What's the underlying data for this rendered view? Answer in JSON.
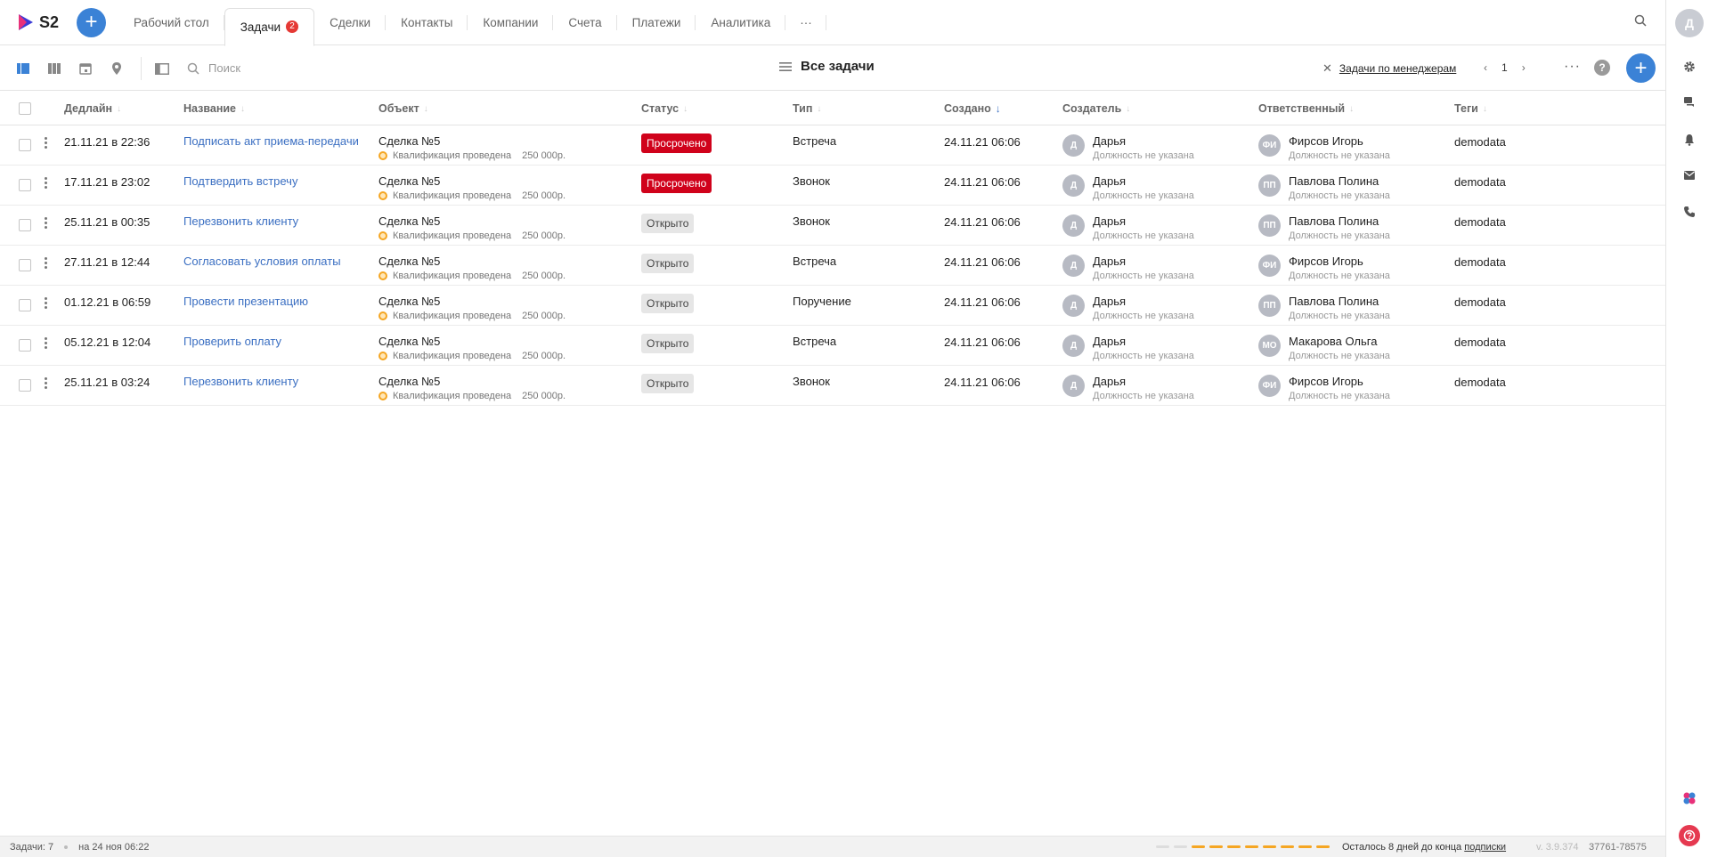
{
  "app": {
    "logo_text": "S2",
    "brand_color": "#3b82d6",
    "add_icon": "plus-icon"
  },
  "tabs": [
    {
      "label": "Рабочий стол"
    },
    {
      "label": "Задачи",
      "badge": "2",
      "active": true
    },
    {
      "label": "Сделки"
    },
    {
      "label": "Контакты"
    },
    {
      "label": "Компании"
    },
    {
      "label": "Счета"
    },
    {
      "label": "Платежи"
    },
    {
      "label": "Аналитика"
    },
    {
      "label": "···"
    }
  ],
  "user": {
    "initial": "Д"
  },
  "toolbar": {
    "search_placeholder": "Поиск",
    "view_title": "Все задачи",
    "filter_label": "Задачи по менеджерам",
    "page": "1",
    "more": "···",
    "help": "?"
  },
  "columns": {
    "deadline": "Дедлайн",
    "name": "Название",
    "object": "Объект",
    "status": "Статус",
    "type": "Тип",
    "created": "Создано",
    "creator": "Создатель",
    "responsible": "Ответственный",
    "tags": "Теги"
  },
  "rows": [
    {
      "deadline": "21.11.21 в 22:36",
      "name": "Подписать акт приема-передачи",
      "object": "Сделка №5",
      "stage": "Квалификация проведена",
      "amount": "250 000р.",
      "status": "Просрочено",
      "status_kind": "overdue",
      "type": "Встреча",
      "created": "24.11.21 06:06",
      "creator_initials": "Д",
      "creator": "Дарья",
      "creator_pos": "Должность не указана",
      "resp_initials": "ФИ",
      "responsible": "Фирсов Игорь",
      "resp_pos": "Должность не указана",
      "tags": "demodata"
    },
    {
      "deadline": "17.11.21 в 23:02",
      "name": "Подтвердить встречу",
      "object": "Сделка №5",
      "stage": "Квалификация проведена",
      "amount": "250 000р.",
      "status": "Просрочено",
      "status_kind": "overdue",
      "type": "Звонок",
      "created": "24.11.21 06:06",
      "creator_initials": "Д",
      "creator": "Дарья",
      "creator_pos": "Должность не указана",
      "resp_initials": "ПП",
      "responsible": "Павлова Полина",
      "resp_pos": "Должность не указана",
      "tags": "demodata"
    },
    {
      "deadline": "25.11.21 в 00:35",
      "name": "Перезвонить клиенту",
      "object": "Сделка №5",
      "stage": "Квалификация проведена",
      "amount": "250 000р.",
      "status": "Открыто",
      "status_kind": "open",
      "type": "Звонок",
      "created": "24.11.21 06:06",
      "creator_initials": "Д",
      "creator": "Дарья",
      "creator_pos": "Должность не указана",
      "resp_initials": "ПП",
      "responsible": "Павлова Полина",
      "resp_pos": "Должность не указана",
      "tags": "demodata"
    },
    {
      "deadline": "27.11.21 в 12:44",
      "name": "Согласовать условия оплаты",
      "object": "Сделка №5",
      "stage": "Квалификация проведена",
      "amount": "250 000р.",
      "status": "Открыто",
      "status_kind": "open",
      "type": "Встреча",
      "created": "24.11.21 06:06",
      "creator_initials": "Д",
      "creator": "Дарья",
      "creator_pos": "Должность не указана",
      "resp_initials": "ФИ",
      "responsible": "Фирсов Игорь",
      "resp_pos": "Должность не указана",
      "tags": "demodata"
    },
    {
      "deadline": "01.12.21 в 06:59",
      "name": "Провести презентацию",
      "object": "Сделка №5",
      "stage": "Квалификация проведена",
      "amount": "250 000р.",
      "status": "Открыто",
      "status_kind": "open",
      "type": "Поручение",
      "created": "24.11.21 06:06",
      "creator_initials": "Д",
      "creator": "Дарья",
      "creator_pos": "Должность не указана",
      "resp_initials": "ПП",
      "responsible": "Павлова Полина",
      "resp_pos": "Должность не указана",
      "tags": "demodata"
    },
    {
      "deadline": "05.12.21 в 12:04",
      "name": "Проверить оплату",
      "object": "Сделка №5",
      "stage": "Квалификация проведена",
      "amount": "250 000р.",
      "status": "Открыто",
      "status_kind": "open",
      "type": "Встреча",
      "created": "24.11.21 06:06",
      "creator_initials": "Д",
      "creator": "Дарья",
      "creator_pos": "Должность не указана",
      "resp_initials": "МО",
      "responsible": "Макарова Ольга",
      "resp_pos": "Должность не указана",
      "tags": "demodata"
    },
    {
      "deadline": "25.11.21 в 03:24",
      "name": "Перезвонить клиенту",
      "object": "Сделка №5",
      "stage": "Квалификация проведена",
      "amount": "250 000р.",
      "status": "Открыто",
      "status_kind": "open",
      "type": "Звонок",
      "created": "24.11.21 06:06",
      "creator_initials": "Д",
      "creator": "Дарья",
      "creator_pos": "Должность не указана",
      "resp_initials": "ФИ",
      "responsible": "Фирсов Игорь",
      "resp_pos": "Должность не указана",
      "tags": "demodata"
    }
  ],
  "footer": {
    "count": "Задачи: 7",
    "as_of": "на 24 ноя 06:22",
    "subscription_prefix": "Осталось 8 дней до конца",
    "subscription_link": "подписки",
    "version": "v. 3.9.374",
    "number": "37761-78575",
    "subscription_progress": 0.8
  },
  "colors": {
    "overdue": "#d0021b",
    "open": "#e6e6e6",
    "link": "#3b6fc2",
    "warning": "#f5a623"
  }
}
